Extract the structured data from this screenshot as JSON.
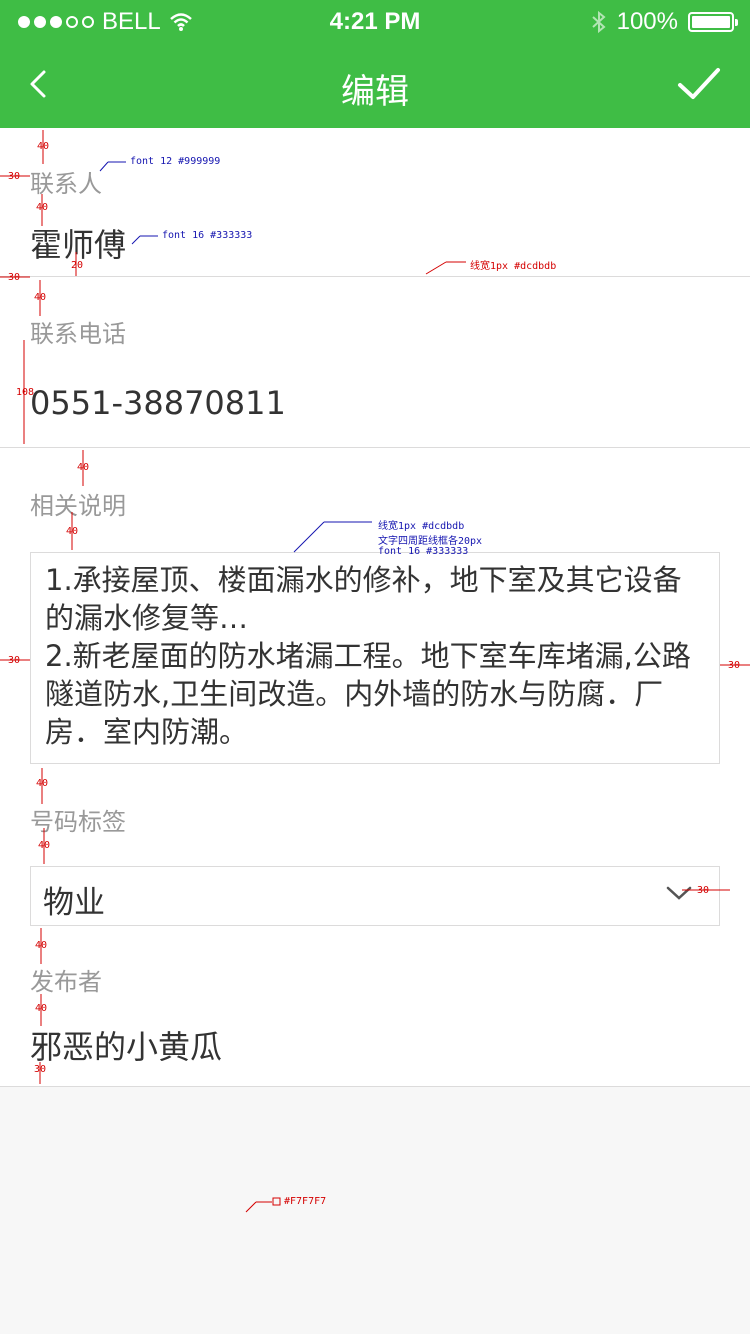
{
  "status_bar": {
    "carrier": "BELL",
    "time": "4:21 PM",
    "battery": "100%"
  },
  "nav": {
    "title": "编辑",
    "back_icon": "chevron-left-icon",
    "confirm_icon": "checkmark-icon"
  },
  "form": {
    "contact_label": "联系人",
    "contact_value": "霍师傅",
    "phone_label": "联系电话",
    "phone_value": "0551-38870811",
    "desc_label": "相关说明",
    "desc_value": "1.承接屋顶、楼面漏水的修补，地下室及其它设备的漏水修复等…\n2.新老屋面的防水堵漏工程。地下室车库堵漏,公路隧道防水,卫生间改造。内外墙的防水与防腐．厂房．室内防潮。",
    "tag_label": "号码标签",
    "tag_value": "物业",
    "publisher_label": "发布者",
    "publisher_value": "邪恶的小黄瓜"
  },
  "annotations": {
    "label_font": "font 12 #999999",
    "value_font": "font 16 #333333",
    "line_spec": "线宽1px #dcdbdb",
    "box_spec_1": "线宽1px #dcdbdb",
    "box_spec_2": "文字四周距线框各20px",
    "box_spec_3": "font 16 #333333",
    "bg_spec": "#F7F7F7",
    "m40": "40",
    "m30": "30",
    "m20": "20",
    "m108": "108"
  },
  "colors": {
    "brand_green": "#3fbd45",
    "divider": "#dcdbdb",
    "label": "#999999",
    "text": "#333333",
    "page_bg": "#f7f7f7"
  }
}
